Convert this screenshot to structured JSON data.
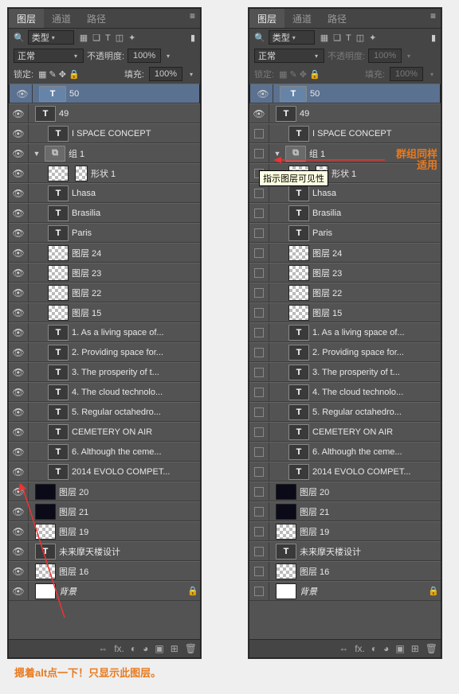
{
  "tabs": {
    "layers": "图层",
    "channels": "通道",
    "paths": "路径"
  },
  "filter": {
    "label": "类型"
  },
  "blend": {
    "mode": "正常",
    "opacity_label": "不透明度:",
    "opacity": "100%"
  },
  "lock": {
    "label": "锁定:",
    "fill_label": "填充:",
    "fill": "100%"
  },
  "layers": [
    {
      "kind": "text",
      "name": "50",
      "selected": true
    },
    {
      "kind": "text",
      "name": "49"
    },
    {
      "kind": "text",
      "name": "I   SPACE CONCEPT",
      "indent": 1
    },
    {
      "kind": "group",
      "name": "组 1",
      "open": true
    },
    {
      "kind": "shape",
      "name": "形状 1",
      "indent": 1
    },
    {
      "kind": "text",
      "name": "Lhasa",
      "indent": 1
    },
    {
      "kind": "text",
      "name": "Brasilia",
      "indent": 1
    },
    {
      "kind": "text",
      "name": "Paris",
      "indent": 1
    },
    {
      "kind": "raster",
      "name": "图层 24",
      "indent": 1
    },
    {
      "kind": "raster",
      "name": "图层 23",
      "indent": 1
    },
    {
      "kind": "raster",
      "name": "图层 22",
      "indent": 1
    },
    {
      "kind": "raster",
      "name": "图层 15",
      "indent": 1
    },
    {
      "kind": "text",
      "name": "1. As a living space of...",
      "indent": 1
    },
    {
      "kind": "text",
      "name": "2. Providing space for...",
      "indent": 1
    },
    {
      "kind": "text",
      "name": "3. The prosperity of t...",
      "indent": 1
    },
    {
      "kind": "text",
      "name": "4. The cloud technolo...",
      "indent": 1
    },
    {
      "kind": "text",
      "name": "5. Regular octahedro...",
      "indent": 1
    },
    {
      "kind": "text",
      "name": "CEMETERY ON AIR",
      "indent": 1
    },
    {
      "kind": "text",
      "name": "6. Although the ceme...",
      "indent": 1
    },
    {
      "kind": "text",
      "name": "2014 EVOLO COMPET...",
      "indent": 1
    },
    {
      "kind": "dark",
      "name": "图层 20"
    },
    {
      "kind": "dark",
      "name": "图层 21"
    },
    {
      "kind": "raster",
      "name": "图层 19"
    },
    {
      "kind": "text",
      "name": "未来摩天楼设计"
    },
    {
      "kind": "raster",
      "name": "图层 16"
    },
    {
      "kind": "bg",
      "name": "背景",
      "locked": true
    }
  ],
  "ann_left": "摁着alt点一下！只显示此图层。",
  "ann_right": "群组同样适用",
  "tooltip_right": "指示图层可见性",
  "footicons": {
    "link": "⇔",
    "fx": "fx.",
    "mask": "◐",
    "adj": "◕",
    "group": "▣",
    "new": "⊞",
    "trash": "🗑"
  }
}
